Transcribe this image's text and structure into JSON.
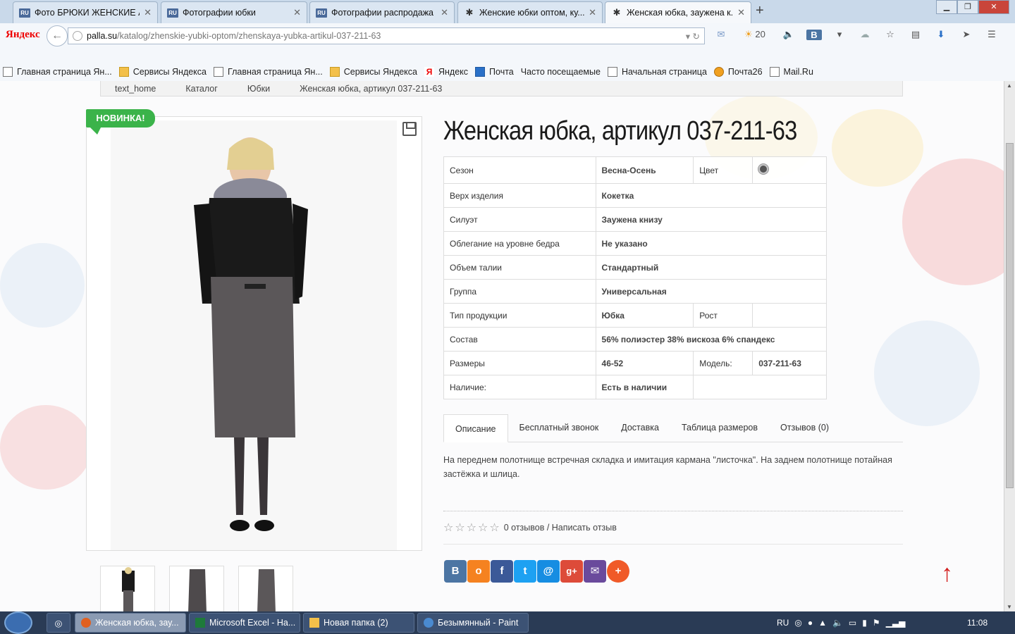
{
  "browser": {
    "tabs": [
      {
        "label": "Фото БРЮКИ ЖЕНСКИЕ А...",
        "favicon": "RU"
      },
      {
        "label": "Фотографии юбки",
        "favicon": "RU"
      },
      {
        "label": "Фотографии распродажа",
        "favicon": "RU"
      },
      {
        "label": "Женские юбки оптом, ку...",
        "favicon": "people"
      },
      {
        "label": "Женская юбка, заужена к...",
        "favicon": "people",
        "active": true
      }
    ],
    "logo": "Яндекс",
    "url_domain": "palla.su",
    "url_path": "/katalog/zhenskie-yubki-optom/zhenskaya-yubka-artikul-037-211-63",
    "weather_temp": "20",
    "vk_label": "В",
    "bookmarks": [
      {
        "label": "Главная страница Ян...",
        "icon": "page"
      },
      {
        "label": "Сервисы Яндекса",
        "icon": "folder"
      },
      {
        "label": "Главная страница Ян...",
        "icon": "page"
      },
      {
        "label": "Сервисы Яндекса",
        "icon": "folder"
      },
      {
        "label": "Яндекс",
        "icon": "ya"
      },
      {
        "label": "Почта",
        "icon": "mail"
      },
      {
        "label": "Часто посещаемые",
        "icon": "none"
      },
      {
        "label": "Начальная страница",
        "icon": "page"
      },
      {
        "label": "Почта26",
        "icon": "p26"
      },
      {
        "label": "Mail.Ru",
        "icon": "page"
      }
    ]
  },
  "breadcrumb": [
    "text_home",
    "Каталог",
    "Юбки",
    "Женская юбка, артикул 037-211-63"
  ],
  "product": {
    "badge": "НОВИНКА!",
    "title": "Женская юбка, артикул 037-211-63",
    "props": {
      "season_label": "Сезон",
      "season": "Весна-Осень",
      "color_label": "Цвет",
      "color_hex": "#555555",
      "top_label": "Верх изделия",
      "top": "Кокетка",
      "silhouette_label": "Силуэт",
      "silhouette": "Заужена книзу",
      "fit_label": "Облегание на уровне бедра",
      "fit": "Не указано",
      "waist_label": "Объем талии",
      "waist": "Стандартный",
      "group_label": "Группа",
      "group": "Универсальная",
      "type_label": "Тип продукции",
      "type": "Юбка",
      "height_label": "Рост",
      "height": "",
      "composition_label": "Состав",
      "composition": "56% полиэстер 38% вискоза 6% спандекс",
      "sizes_label": "Размеры",
      "sizes": "46-52",
      "model_label": "Модель:",
      "model": "037-211-63",
      "stock_label": "Наличие:",
      "stock": "Есть в наличии"
    },
    "tabs": [
      "Описание",
      "Бесплатный звонок",
      "Доставка",
      "Таблица размеров",
      "Отзывов (0)"
    ],
    "description": "На переднем полотнище встречная складка и имитация кармана \"листочка\". На заднем полотнище потайная застёжка и шлица.",
    "reviews_text": "0 отзывов / Написать отзыв",
    "stars": "☆☆☆☆☆",
    "share_buttons": [
      {
        "name": "vk",
        "glyph": "В",
        "color": "#4c75a3"
      },
      {
        "name": "odnoklassniki",
        "glyph": "o",
        "color": "#f58220"
      },
      {
        "name": "facebook",
        "glyph": "f",
        "color": "#3b5998"
      },
      {
        "name": "twitter",
        "glyph": "t",
        "color": "#1da1f2"
      },
      {
        "name": "mailru",
        "glyph": "@",
        "color": "#168de2"
      },
      {
        "name": "googleplus",
        "glyph": "g+",
        "color": "#dd4b39"
      },
      {
        "name": "email",
        "glyph": "✉",
        "color": "#6a4a9c"
      },
      {
        "name": "more",
        "glyph": "+",
        "color": "#f05a28"
      }
    ]
  },
  "taskbar": {
    "items": [
      {
        "label": "Женская юбка, зау...",
        "active": true,
        "icon_color": "#e06020"
      },
      {
        "label": "Microsoft Excel - На...",
        "active": false,
        "icon_color": "#1e7a3a"
      },
      {
        "label": "Новая папка (2)",
        "active": false,
        "icon_color": "#f3c04a"
      },
      {
        "label": "Безымянный - Paint",
        "active": false,
        "icon_color": "#4a8ad0"
      }
    ],
    "lang": "RU",
    "clock": "11:08"
  }
}
